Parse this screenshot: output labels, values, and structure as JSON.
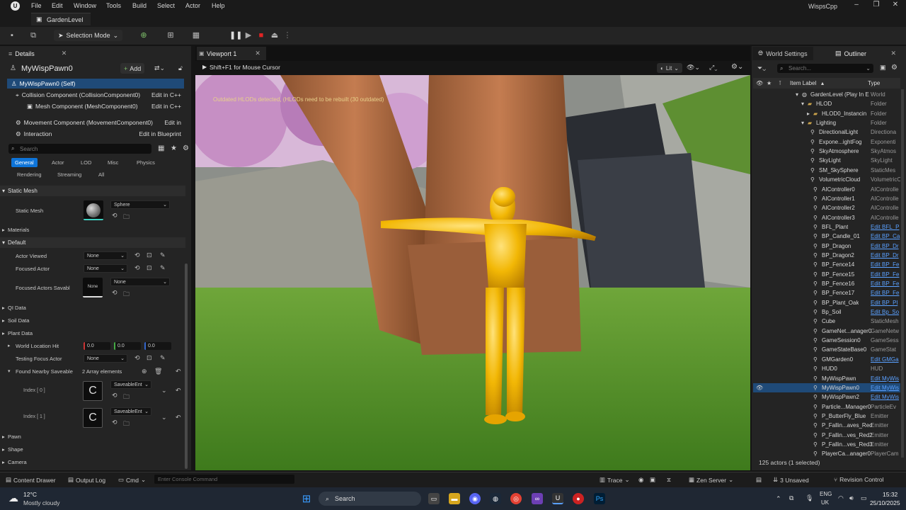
{
  "menubar": {
    "items": [
      "File",
      "Edit",
      "Window",
      "Tools",
      "Build",
      "Select",
      "Actor",
      "Help"
    ],
    "project": "WispsCpp"
  },
  "level_tab": "GardenLevel",
  "toolbar": {
    "selection_mode": "Selection Mode"
  },
  "details": {
    "tab": "Details",
    "actor_name": "MyWispPawn0",
    "add_label": "Add",
    "components": [
      {
        "name": "MyWispPawn0 (Self)",
        "edit": ""
      },
      {
        "name": "Collision Component (CollisionComponent0)",
        "edit": "Edit in C++"
      },
      {
        "name": "Mesh Component (MeshComponent0)",
        "edit": "Edit in C++"
      },
      {
        "name": "Movement Component (MovementComponent0)",
        "edit": "Edit in"
      },
      {
        "name": "Interaction",
        "edit": "Edit in Blueprint"
      }
    ],
    "search_placeholder": "Search",
    "categories_row1": [
      "General",
      "Actor",
      "LOD",
      "Misc",
      "Physics"
    ],
    "categories_row2": [
      "Rendering",
      "Streaming",
      "All"
    ],
    "sections": {
      "static_mesh": "Static Mesh",
      "materials": "Materials",
      "default": "Default",
      "qi_data": "QI Data",
      "soil_data": "Soil Data",
      "plant_data": "Plant Data",
      "pawn": "Pawn",
      "shape": "Shape",
      "camera": "Camera"
    },
    "static_mesh_label": "Static Mesh",
    "static_mesh_value": "Sphere",
    "actor_viewed_label": "Actor Viewed",
    "actor_viewed_value": "None",
    "focused_actor_label": "Focused Actor",
    "focused_actor_value": "None",
    "focused_actors_savable_label": "Focused Actors Savabl",
    "focused_actors_savable_thumb": "None",
    "focused_actors_savable_value": "None",
    "world_location_label": "World Location Hit",
    "world_location_values": [
      "0.0",
      "0.0",
      "0.0"
    ],
    "testing_focus_label": "Testing Focus Actor",
    "testing_focus_value": "None",
    "found_nearby_label": "Found Nearby Saveable",
    "found_nearby_count": "2 Array elements",
    "index0_label": "Index [ 0 ]",
    "index1_label": "Index [ 1 ]",
    "saveable_value": "SaveableEnt"
  },
  "viewport": {
    "tab": "Viewport 1",
    "hint": "Shift+F1 for Mouse Cursor",
    "lit": "Lit",
    "warning": "Outdated HLODs detected, (HLODs need to be rebuilt (30 outdated)"
  },
  "right": {
    "world_settings_tab": "World Settings",
    "outliner_tab": "Outliner",
    "search_placeholder": "Search...",
    "col_label": "Item Label",
    "col_type": "Type",
    "rows": [
      {
        "label": "GardenLevel (Play In E",
        "type": "World",
        "indent": 0,
        "icon": "▾",
        "link": false
      },
      {
        "label": "HLOD",
        "type": "Folder",
        "indent": 1,
        "icon": "▾",
        "link": false
      },
      {
        "label": "HLOD0_Instancin",
        "type": "Folder",
        "indent": 2,
        "icon": "▸",
        "link": false
      },
      {
        "label": "Lighting",
        "type": "Folder",
        "indent": 1,
        "icon": "▾",
        "link": false
      },
      {
        "label": "DirectionalLight",
        "type": "Directiona",
        "indent": 3,
        "icon": "",
        "link": false
      },
      {
        "label": "Expone...ightFog",
        "type": "Exponenti",
        "indent": 3,
        "icon": "",
        "link": false
      },
      {
        "label": "SkyAtmosphere",
        "type": "SkyAtmos",
        "indent": 3,
        "icon": "",
        "link": false
      },
      {
        "label": "SkyLight",
        "type": "SkyLight",
        "indent": 3,
        "icon": "",
        "link": false
      },
      {
        "label": "SM_SkySphere",
        "type": "StaticMes",
        "indent": 3,
        "icon": "",
        "link": false
      },
      {
        "label": "VolumetricCloud",
        "type": "VolumetricC",
        "indent": 3,
        "icon": "",
        "link": false
      },
      {
        "label": "AIController0",
        "type": "AIControlle",
        "indent": 2,
        "icon": "",
        "link": false
      },
      {
        "label": "AIController1",
        "type": "AIControlle",
        "indent": 2,
        "icon": "",
        "link": false
      },
      {
        "label": "AIController2",
        "type": "AIControlle",
        "indent": 2,
        "icon": "",
        "link": false
      },
      {
        "label": "AIController3",
        "type": "AIControlle",
        "indent": 2,
        "icon": "",
        "link": false
      },
      {
        "label": "BFL_Plant",
        "type": "Edit BFL_P",
        "indent": 2,
        "icon": "",
        "link": true
      },
      {
        "label": "BP_Candle_01",
        "type": "Edit BP_Ca",
        "indent": 2,
        "icon": "",
        "link": true
      },
      {
        "label": "BP_Dragon",
        "type": "Edit BP_Dr",
        "indent": 2,
        "icon": "",
        "link": true
      },
      {
        "label": "BP_Dragon2",
        "type": "Edit BP_Dr",
        "indent": 2,
        "icon": "",
        "link": true
      },
      {
        "label": "BP_Fence14",
        "type": "Edit BP_Fe",
        "indent": 2,
        "icon": "",
        "link": true
      },
      {
        "label": "BP_Fence15",
        "type": "Edit BP_Fe",
        "indent": 2,
        "icon": "",
        "link": true
      },
      {
        "label": "BP_Fence16",
        "type": "Edit BP_Fe",
        "indent": 2,
        "icon": "",
        "link": true
      },
      {
        "label": "BP_Fence17",
        "type": "Edit BP_Fe",
        "indent": 2,
        "icon": "",
        "link": true
      },
      {
        "label": "BP_Plant_Oak",
        "type": "Edit BP_Pl",
        "indent": 2,
        "icon": "",
        "link": true
      },
      {
        "label": "Bp_Soil",
        "type": "Edit Bp_So",
        "indent": 2,
        "icon": "",
        "link": true
      },
      {
        "label": "Cube",
        "type": "StaticMesh",
        "indent": 2,
        "icon": "",
        "link": false
      },
      {
        "label": "GameNet...anager0",
        "type": "GameNetw",
        "indent": 2,
        "icon": "",
        "link": false
      },
      {
        "label": "GameSession0",
        "type": "GameSess",
        "indent": 2,
        "icon": "",
        "link": false
      },
      {
        "label": "GameStateBase0",
        "type": "GameStat",
        "indent": 2,
        "icon": "",
        "link": false
      },
      {
        "label": "GMGarden0",
        "type": "Edit GMGa",
        "indent": 2,
        "icon": "",
        "link": true
      },
      {
        "label": "HUD0",
        "type": "HUD",
        "indent": 2,
        "icon": "",
        "link": false
      },
      {
        "label": "MyWispPawn",
        "type": "Edit MyWis",
        "indent": 2,
        "icon": "",
        "link": true
      },
      {
        "label": "MyWispPawn0",
        "type": "Edit MyWis",
        "indent": 2,
        "icon": "",
        "link": true,
        "selected": true
      },
      {
        "label": "MyWispPawn2",
        "type": "Edit MyWis",
        "indent": 2,
        "icon": "",
        "link": true
      },
      {
        "label": "Particle...Manager0",
        "type": "ParticleEv",
        "indent": 2,
        "icon": "",
        "link": false
      },
      {
        "label": "P_ButterFly_Blue",
        "type": "Emitter",
        "indent": 2,
        "icon": "",
        "link": false
      },
      {
        "label": "P_Fallin...aves_Red",
        "type": "Emitter",
        "indent": 2,
        "icon": "",
        "link": false
      },
      {
        "label": "P_Fallin...ves_Red2",
        "type": "Emitter",
        "indent": 2,
        "icon": "",
        "link": false
      },
      {
        "label": "P_Fallin...ves_Red3",
        "type": "Emitter",
        "indent": 2,
        "icon": "",
        "link": false
      },
      {
        "label": "PlayerCa...anager0",
        "type": "PlayerCam",
        "indent": 2,
        "icon": "",
        "link": false
      }
    ],
    "count": "125 actors (1 selected)"
  },
  "statusbar": {
    "content_drawer": "Content Drawer",
    "output_log": "Output Log",
    "cmd": "Cmd",
    "console_placeholder": "Enter Console Command",
    "trace": "Trace",
    "zen": "Zen Server",
    "unsaved": "3 Unsaved",
    "revision": "Revision Control"
  },
  "taskbar": {
    "temp": "12°C",
    "weather": "Mostly cloudy",
    "search": "Search",
    "lang1": "ENG",
    "lang2": "UK",
    "time": "15:32",
    "date": "25/10/2025"
  },
  "colors": {
    "accent": "#0e74d8",
    "selection": "#1f4a78",
    "link": "#5aa0ff",
    "mannequin": "#f2b705"
  }
}
